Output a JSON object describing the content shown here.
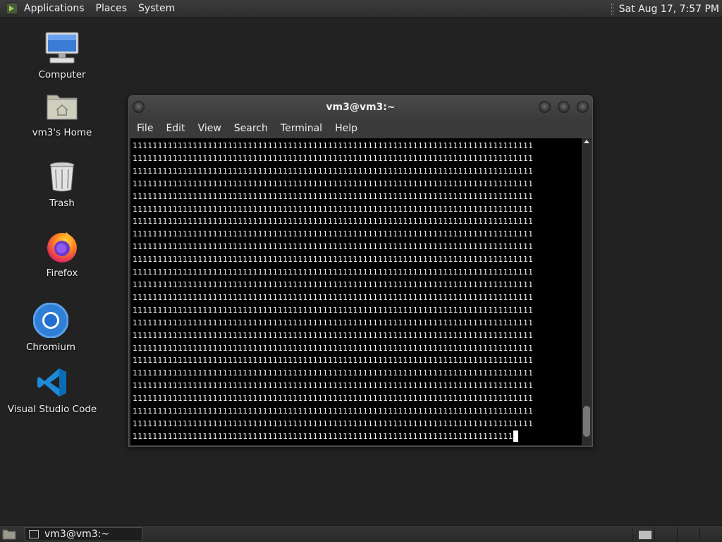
{
  "top_panel": {
    "menus": [
      "Applications",
      "Places",
      "System"
    ],
    "clock": "Sat Aug 17,  7:57 PM"
  },
  "desktop_icons": [
    {
      "label": "Computer",
      "icon": "computer-icon"
    },
    {
      "label": "vm3's Home",
      "icon": "home-folder-icon"
    },
    {
      "label": "Trash",
      "icon": "trash-icon"
    },
    {
      "label": "Firefox",
      "icon": "firefox-icon"
    },
    {
      "label": "Chromium",
      "icon": "chromium-icon"
    },
    {
      "label": "Visual Studio Code",
      "icon": "vscode-icon"
    }
  ],
  "terminal": {
    "title": "vm3@vm3:~",
    "menus": [
      "File",
      "Edit",
      "View",
      "Search",
      "Terminal",
      "Help"
    ],
    "output_line": "11111111111111111111111111111111111111111111111111111111111111111111111111111111",
    "last_line": "1111111111111111111111111111111111111111111111111111111111111111111111111111",
    "full_lines": 23
  },
  "bottom_panel": {
    "task_label": "vm3@vm3:~"
  }
}
